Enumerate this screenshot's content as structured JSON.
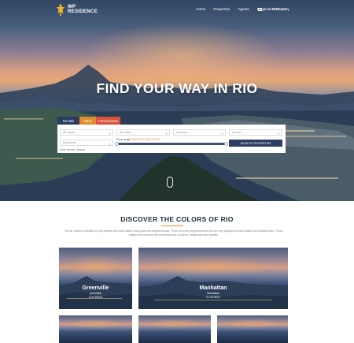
{
  "brand": {
    "name_line1": "WP",
    "name_line2": "RESIDENCE"
  },
  "nav": {
    "items": [
      "Home",
      "Properties",
      "Agents",
      "Blog",
      "Features"
    ],
    "submit_label": "Submit Property"
  },
  "hero": {
    "title": "FIND YOUR WAY IN RIO"
  },
  "search": {
    "tabs": [
      "Rentals",
      "Sales",
      "Foreclosures"
    ],
    "types_placeholder": "All Types",
    "cities_placeholder": "All Cities",
    "areas_placeholder": "All Areas",
    "rooms_placeholder": "Rooms",
    "bedrooms_placeholder": "Bedrooms",
    "price_label": "Price range:",
    "price_value": "$250,000 to $3,700,000",
    "price_range_fraction": [
      0.0,
      1.0
    ],
    "search_button": "SEARCH PROPERTIES",
    "more_options": "More Search Options"
  },
  "section": {
    "title": "DISCOVER THE COLORS OF RIO",
    "description": "Rio de Janeiro is divided up into districts with each district having several neighborhoods. There are a few neighborhoods that are very popular and well visited and beautiful sites. These neighborhoods have the best attractions, beaches, restaurants and nightlife."
  },
  "cards": [
    {
      "name": "Greenville",
      "area": "greenville",
      "count": "8 LISTINGS"
    },
    {
      "name": "Manhattan",
      "area": "Manhattan",
      "count": "5 LISTINGS"
    }
  ],
  "colors": {
    "accent": "#e18d2b",
    "navy": "#2d3e63",
    "red": "#d9533c"
  }
}
